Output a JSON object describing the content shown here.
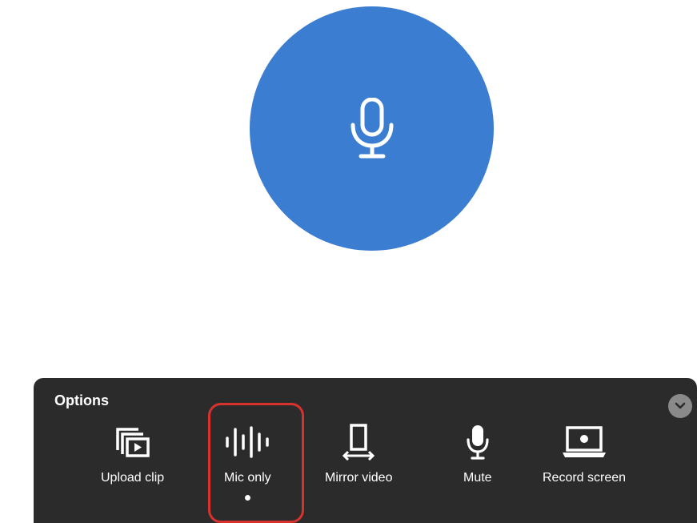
{
  "main": {
    "mic_icon": "microphone-icon",
    "accent_color": "#3b7dd1"
  },
  "options": {
    "title": "Options",
    "collapse_icon": "chevron-down-icon",
    "items": [
      {
        "label": "Upload clip",
        "icon": "upload-clip-icon",
        "selected": false
      },
      {
        "label": "Mic only",
        "icon": "soundwave-icon",
        "selected": true
      },
      {
        "label": "Mirror video",
        "icon": "mirror-video-icon",
        "selected": false
      },
      {
        "label": "Mute",
        "icon": "microphone-icon",
        "selected": false
      },
      {
        "label": "Record screen",
        "icon": "record-screen-icon",
        "selected": false
      }
    ]
  },
  "colors": {
    "panel": "#2b2b2b",
    "highlight": "#d8322e"
  }
}
